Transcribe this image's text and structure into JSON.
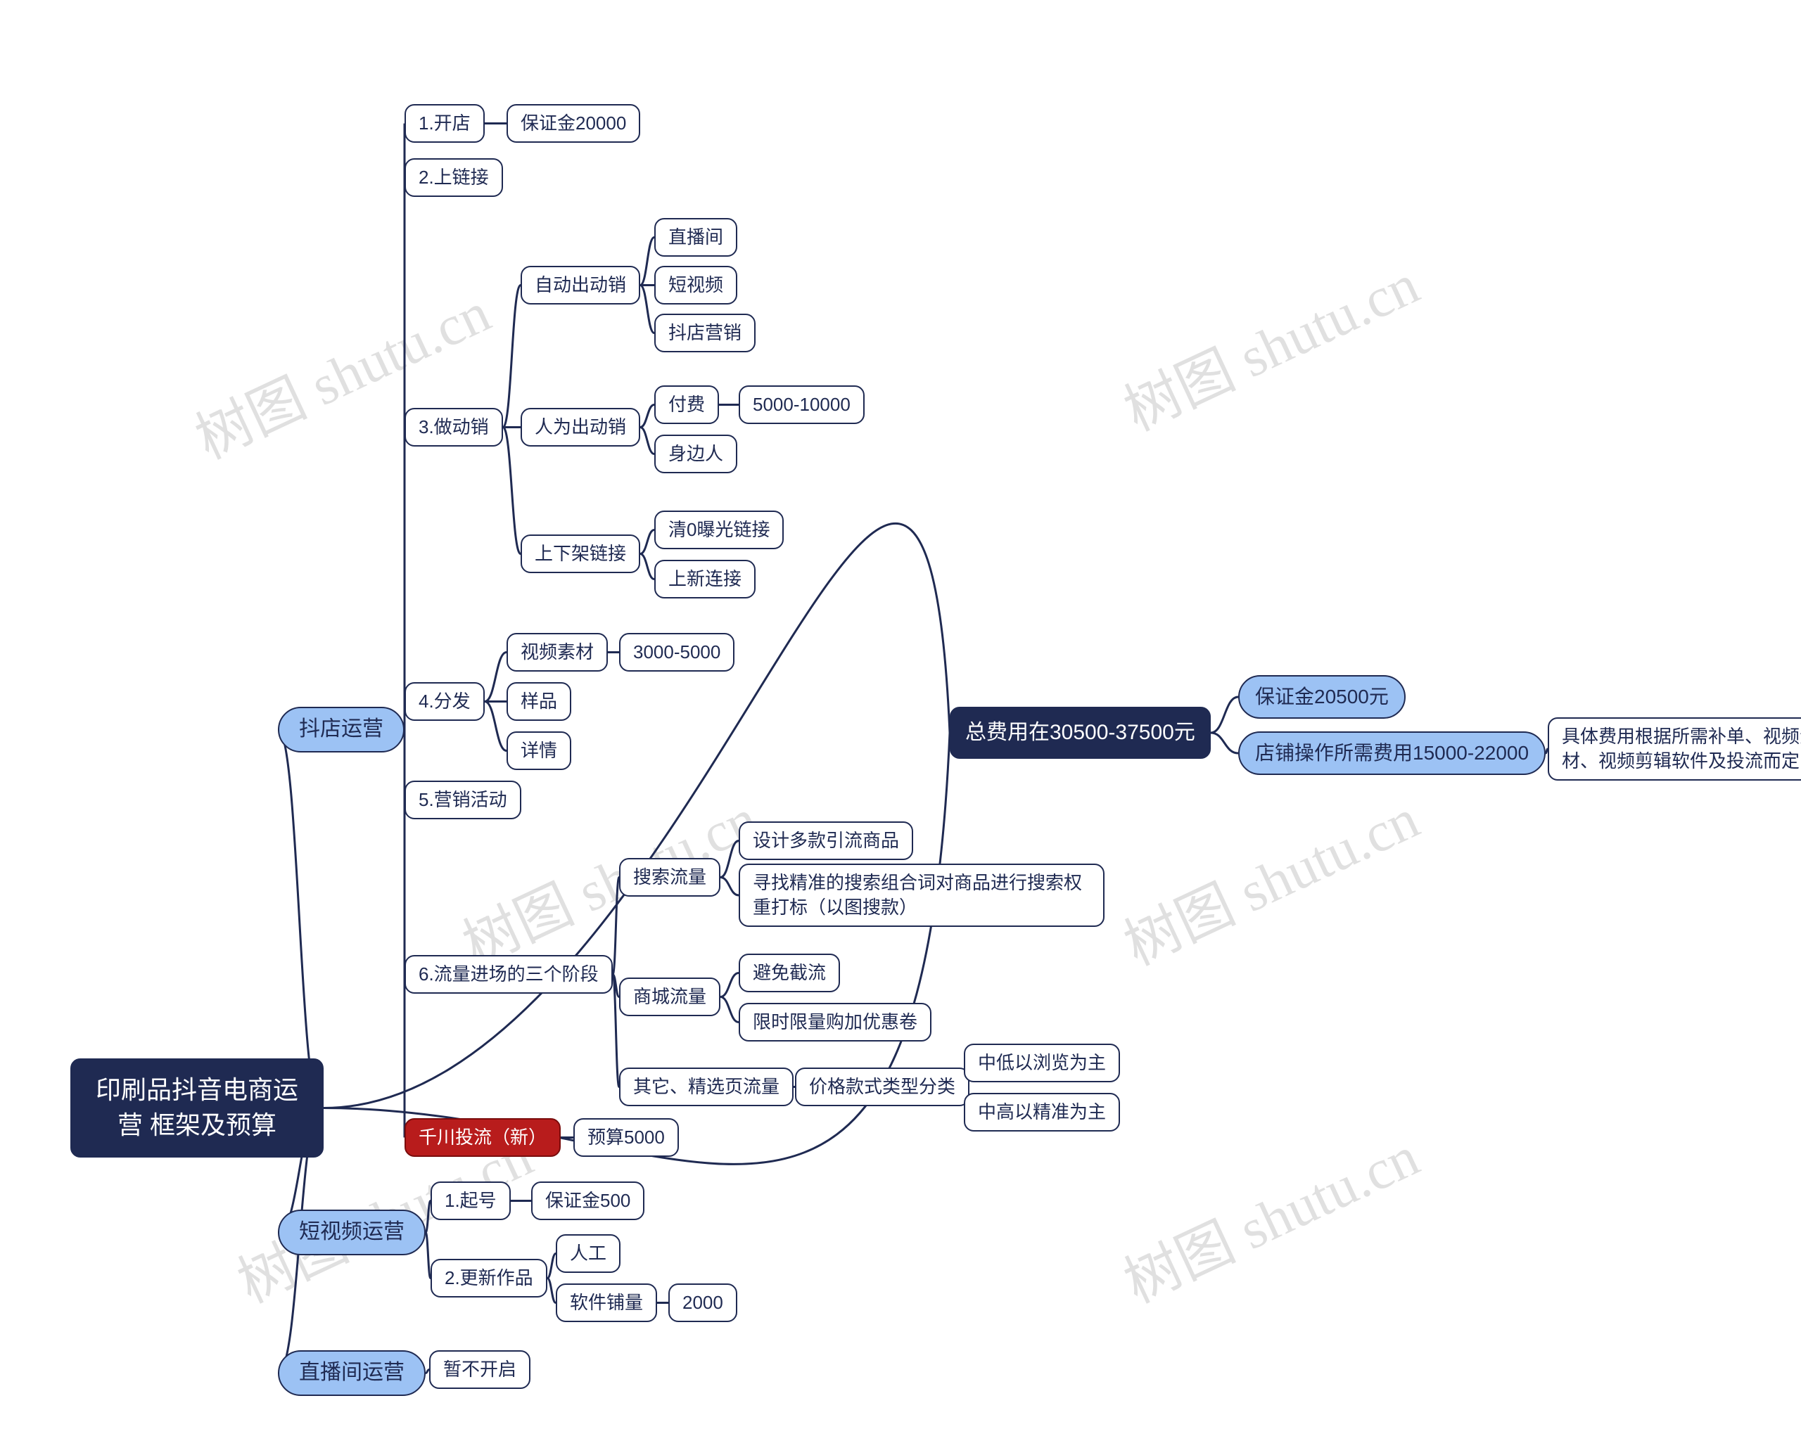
{
  "watermark_text": "树图 shutu.cn",
  "left_map": {
    "root": "印刷品抖音电商运营\n框架及预算",
    "branches": [
      {
        "label": "抖店运营",
        "children": [
          {
            "label": "1.开店",
            "children": [
              {
                "label": "保证金20000"
              }
            ]
          },
          {
            "label": "2.上链接"
          },
          {
            "label": "3.做动销",
            "children": [
              {
                "label": "自动出动销",
                "children": [
                  {
                    "label": "直播间"
                  },
                  {
                    "label": "短视频"
                  },
                  {
                    "label": "抖店营销"
                  }
                ]
              },
              {
                "label": "人为出动销",
                "children": [
                  {
                    "label": "付费",
                    "children": [
                      {
                        "label": "5000-10000"
                      }
                    ]
                  },
                  {
                    "label": "身边人"
                  }
                ]
              },
              {
                "label": "上下架链接",
                "children": [
                  {
                    "label": "清0曝光链接"
                  },
                  {
                    "label": "上新连接"
                  }
                ]
              }
            ]
          },
          {
            "label": "4.分发",
            "children": [
              {
                "label": "视频素材",
                "children": [
                  {
                    "label": "3000-5000"
                  }
                ]
              },
              {
                "label": "样品"
              },
              {
                "label": "详情"
              }
            ]
          },
          {
            "label": "5.营销活动"
          },
          {
            "label": "6.流量进场的三个阶段",
            "children": [
              {
                "label": "搜索流量",
                "children": [
                  {
                    "label": "设计多款引流商品"
                  },
                  {
                    "label": "寻找精准的搜索组合词对商品进行搜索权重打标（以图搜款）"
                  }
                ]
              },
              {
                "label": "商城流量",
                "children": [
                  {
                    "label": "避免截流"
                  },
                  {
                    "label": "限时限量购加优惠卷"
                  }
                ]
              },
              {
                "label": "其它、精选页流量",
                "children": [
                  {
                    "label": "价格款式类型分类",
                    "children": [
                      {
                        "label": "中低以浏览为主"
                      },
                      {
                        "label": "中高以精准为主"
                      }
                    ]
                  }
                ]
              }
            ]
          },
          {
            "label": "千川投流（新）",
            "children": [
              {
                "label": "预算5000"
              }
            ]
          }
        ]
      },
      {
        "label": "短视频运营",
        "children": [
          {
            "label": "1.起号",
            "children": [
              {
                "label": "保证金500"
              }
            ]
          },
          {
            "label": "2.更新作品",
            "children": [
              {
                "label": "人工"
              },
              {
                "label": "软件铺量",
                "children": [
                  {
                    "label": "2000"
                  }
                ]
              }
            ]
          }
        ]
      },
      {
        "label": "直播间运营",
        "children": [
          {
            "label": "暂不开启"
          }
        ]
      }
    ]
  },
  "right_map": {
    "root": "总费用在30500-37500元",
    "children": [
      {
        "label": "保证金20500元"
      },
      {
        "label": "店铺操作所需费用15000-22000",
        "children": [
          {
            "label": "具体费用根据所需补单、视频素材、视频剪辑软件及投流而定"
          }
        ]
      }
    ]
  }
}
